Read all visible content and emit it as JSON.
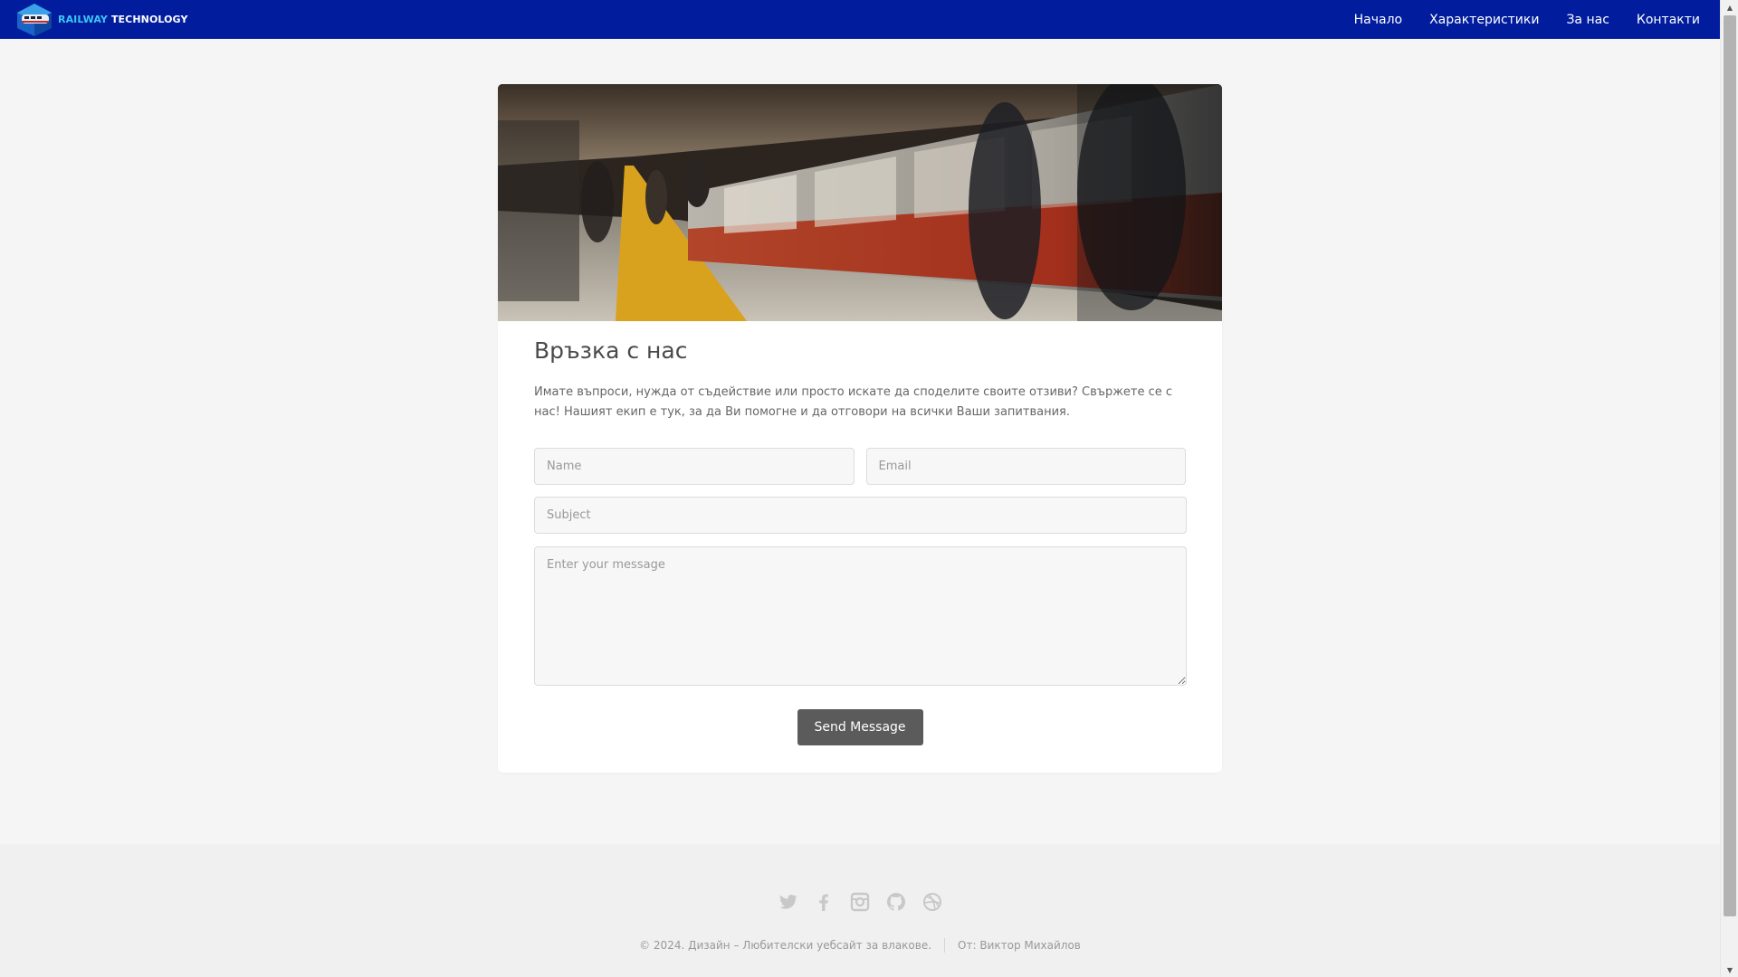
{
  "brand": {
    "word1": "RAILWAY",
    "word2": "TECHNOLOGY",
    "logo_icon": "train-logo-icon",
    "accent_color": "#3cc6f7"
  },
  "nav": {
    "bar_color": "#011d9e",
    "items": [
      {
        "label": "Начало"
      },
      {
        "label": "Характеристики"
      },
      {
        "label": "За нас"
      },
      {
        "label": "Контакти"
      }
    ]
  },
  "hero": {
    "image": "subway-platform-photo"
  },
  "contact": {
    "title": "Връзка с нас",
    "lead": "Имате въпроси, нужда от съдействие или просто искате да споделите своите отзиви? Свържете се с нас! Нашият екип е тук, за да Ви помогне и да отговори на всички Ваши запитвания.",
    "name_placeholder": "Name",
    "email_placeholder": "Email",
    "subject_placeholder": "Subject",
    "message_placeholder": "Enter your message",
    "send_label": "Send Message",
    "button_color": "#5b5b5b"
  },
  "footer": {
    "socials": [
      {
        "icon": "twitter-icon"
      },
      {
        "icon": "facebook-icon"
      },
      {
        "icon": "instagram-icon"
      },
      {
        "icon": "github-icon"
      },
      {
        "icon": "dribbble-icon"
      }
    ],
    "copyright": "© 2024. Дизайн – Любителски уебсайт за влакове.",
    "author": "От: Виктор Михайлов"
  }
}
